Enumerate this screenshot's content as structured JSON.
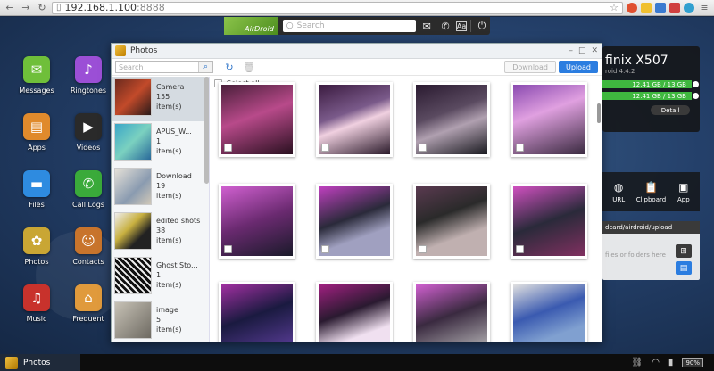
{
  "browser": {
    "url_host": "192.168.1.100",
    "url_port": ":8888"
  },
  "topbar": {
    "logo_text": "AirDroid",
    "search_placeholder": "Search"
  },
  "desktop_icons": [
    {
      "label": "Messages",
      "color": "#6fbf3a"
    },
    {
      "label": "Ringtones",
      "color": "#9b4fd6"
    },
    {
      "label": "Apps",
      "color": "#e08a2c"
    },
    {
      "label": "Videos",
      "color": "#2a2a2a"
    },
    {
      "label": "Files",
      "color": "#2e8be0"
    },
    {
      "label": "Call Logs",
      "color": "#3aaa3a"
    },
    {
      "label": "Photos",
      "color": "#c9a634"
    },
    {
      "label": "Contacts",
      "color": "#c8742c"
    },
    {
      "label": "Music",
      "color": "#c8322c"
    },
    {
      "label": "Frequent",
      "color": "#e09a3c"
    }
  ],
  "window": {
    "title": "Photos",
    "search_placeholder": "Search",
    "download_label": "Download",
    "upload_label": "Upload",
    "select_all_label": "Select all"
  },
  "albums": [
    {
      "name": "Camera",
      "count": "155",
      "unit": "item(s)"
    },
    {
      "name": "APUS_W...",
      "count": "1",
      "unit": "item(s)"
    },
    {
      "name": "Download",
      "count": "19",
      "unit": "item(s)"
    },
    {
      "name": "edited shots",
      "count": "38",
      "unit": "item(s)"
    },
    {
      "name": "Ghost Sto...",
      "count": "1",
      "unit": "item(s)"
    },
    {
      "name": "image",
      "count": "5",
      "unit": "item(s)"
    }
  ],
  "device": {
    "name": "finix X507",
    "version": "roid 4.4.2",
    "storage1": "12.41 GB / 13 GB",
    "storage2": "12.41 GB / 13 GB",
    "detail_label": "Detail"
  },
  "toolbox": [
    {
      "label": "URL",
      "icon": "globe-icon"
    },
    {
      "label": "Clipboard",
      "icon": "clipboard-icon"
    },
    {
      "label": "App",
      "icon": "app-icon"
    }
  ],
  "upload_panel": {
    "path": "dcard/airdroid/upload",
    "menu": "···",
    "hint": "files or folders here"
  },
  "taskbar": {
    "app_label": "Photos",
    "battery": "90%"
  }
}
